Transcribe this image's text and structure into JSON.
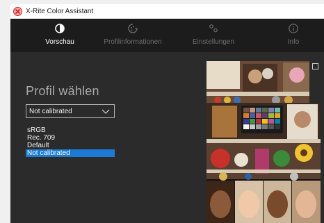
{
  "window": {
    "title": "X-Rite Color Assistant"
  },
  "nav": {
    "items": [
      {
        "label": "Vorschau",
        "icon": "preview-icon",
        "active": true
      },
      {
        "label": "Profilinformationen",
        "icon": "profile-info-icon",
        "active": false
      },
      {
        "label": "Einstellungen",
        "icon": "settings-icon",
        "active": false
      },
      {
        "label": "Info",
        "icon": "info-icon",
        "active": false
      }
    ]
  },
  "main": {
    "heading": "Profil wählen",
    "select_value": "Not calibrated",
    "options": [
      "sRGB",
      "Rec. 709",
      "Default",
      "Not calibrated"
    ],
    "selected_option": "Not calibrated"
  },
  "colors": {
    "accent": "#1b7bd4",
    "nav_background": "#1c1c1c",
    "panel_background": "#2b2b2b"
  }
}
